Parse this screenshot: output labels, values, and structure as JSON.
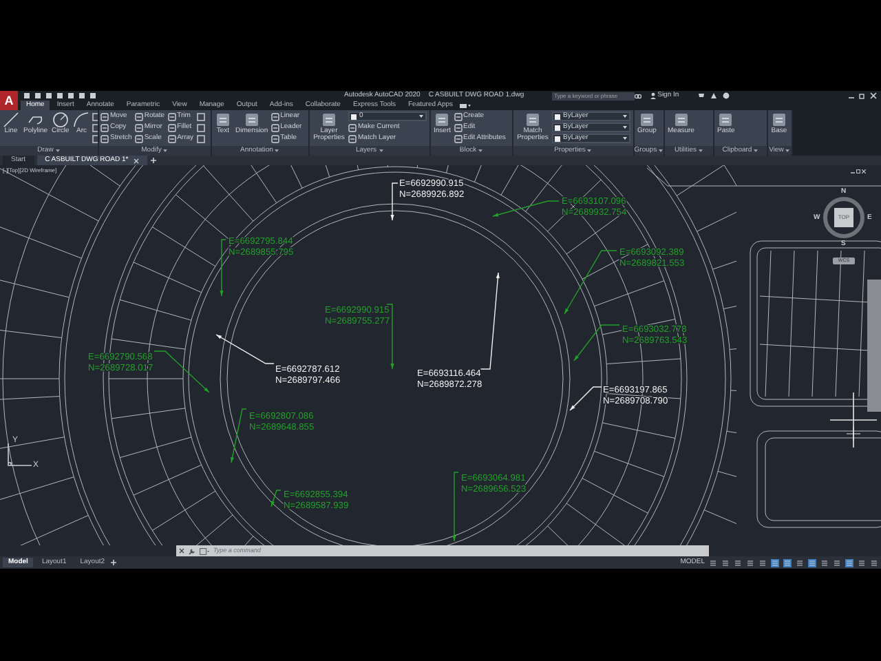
{
  "title_bar": {
    "app_logo": "A",
    "app": "Autodesk AutoCAD 2020",
    "document": "C ASBUILT DWG ROAD 1.dwg",
    "search": {
      "placeholder": "Type a keyword or phrase"
    },
    "sign_in": "Sign In"
  },
  "ribbon_tabs": [
    {
      "label": "Home",
      "selected": true
    },
    {
      "label": "Insert",
      "selected": false
    },
    {
      "label": "Annotate",
      "selected": false
    },
    {
      "label": "Parametric",
      "selected": false
    },
    {
      "label": "View",
      "selected": false
    },
    {
      "label": "Manage",
      "selected": false
    },
    {
      "label": "Output",
      "selected": false
    },
    {
      "label": "Add-ins",
      "selected": false
    },
    {
      "label": "Collaborate",
      "selected": false
    },
    {
      "label": "Express Tools",
      "selected": false
    },
    {
      "label": "Featured Apps",
      "selected": false
    }
  ],
  "ribbon_panels": [
    {
      "title": "Draw",
      "tools": [
        {
          "kind": "large",
          "label": "Line"
        },
        {
          "kind": "large",
          "label": "Polyline"
        },
        {
          "kind": "large",
          "label": "Circle"
        },
        {
          "kind": "large",
          "label": "Arc"
        },
        {
          "kind": "icon"
        },
        {
          "kind": "icon"
        },
        {
          "kind": "icon"
        }
      ]
    },
    {
      "title": "Modify",
      "tools": [
        {
          "kind": "small",
          "label": "Move"
        },
        {
          "kind": "small",
          "label": "Copy"
        },
        {
          "kind": "small",
          "label": "Stretch"
        },
        {
          "kind": "small",
          "label": "Rotate"
        },
        {
          "kind": "small",
          "label": "Mirror"
        },
        {
          "kind": "small",
          "label": "Scale"
        },
        {
          "kind": "small",
          "label": "Trim"
        },
        {
          "kind": "small",
          "label": "Fillet"
        },
        {
          "kind": "small",
          "label": "Array"
        },
        {
          "kind": "icon"
        },
        {
          "kind": "icon"
        },
        {
          "kind": "icon"
        }
      ]
    },
    {
      "title": "Annotation",
      "tools": [
        {
          "kind": "large",
          "label": "Text"
        },
        {
          "kind": "large",
          "label": "Dimension"
        },
        {
          "kind": "small",
          "label": "Linear"
        },
        {
          "kind": "small",
          "label": "Leader"
        },
        {
          "kind": "small",
          "label": "Table"
        }
      ]
    },
    {
      "title": "Layers",
      "tools": [
        {
          "kind": "large",
          "label": "Layer Properties"
        },
        {
          "kind": "dropdown",
          "label": "0"
        },
        {
          "kind": "small",
          "label": "Make Current"
        },
        {
          "kind": "small",
          "label": "Match Layer"
        }
      ]
    },
    {
      "title": "Block",
      "tools": [
        {
          "kind": "large",
          "label": "Insert"
        },
        {
          "kind": "small",
          "label": "Create"
        },
        {
          "kind": "small",
          "label": "Edit"
        },
        {
          "kind": "small",
          "label": "Edit Attributes"
        }
      ]
    },
    {
      "title": "Properties",
      "tools": [
        {
          "kind": "large",
          "label": "Match Properties"
        },
        {
          "kind": "dropdown",
          "label": "ByLayer"
        },
        {
          "kind": "dropdown",
          "label": "ByLayer"
        },
        {
          "kind": "dropdown",
          "label": "ByLayer"
        }
      ]
    },
    {
      "title": "Groups",
      "tools": [
        {
          "kind": "large",
          "label": "Group"
        }
      ]
    },
    {
      "title": "Utilities",
      "tools": [
        {
          "kind": "large",
          "label": "Measure"
        }
      ]
    },
    {
      "title": "Clipboard",
      "tools": [
        {
          "kind": "large",
          "label": "Paste"
        }
      ]
    },
    {
      "title": "View",
      "tools": [
        {
          "kind": "large",
          "label": "Base"
        }
      ]
    }
  ],
  "file_tabs": [
    {
      "label": "Start",
      "selected": false,
      "closable": false
    },
    {
      "label": "C ASBUILT DWG ROAD 1*",
      "selected": true,
      "closable": true
    }
  ],
  "viewport_label": "[-][Top][2D Wireframe]",
  "viewcube": {
    "face": "TOP",
    "north": "N",
    "south": "S",
    "east": "E",
    "west": "W",
    "ucs": "WCS"
  },
  "ucs_icon": {
    "x": "X",
    "y": "Y"
  },
  "coordinate_labels": [
    {
      "e": "E=6692990.915",
      "n": "N=2689926.892",
      "color": "#f0f0f0"
    },
    {
      "e": "E=6692787.612",
      "n": "N=2689797.466",
      "color": "#f0f0f0"
    },
    {
      "e": "E=6693116.464",
      "n": "N=2689872.278",
      "color": "#f0f0f0"
    },
    {
      "e": "E=6693197.865",
      "n": "N=2689708.790",
      "color": "#f0f0f0"
    },
    {
      "e": "E=6693107.096",
      "n": "N=2689932.754",
      "color": "#22a02a"
    },
    {
      "e": "E=6692795.844",
      "n": "N=2689855.795",
      "color": "#22a02a"
    },
    {
      "e": "E=6693092.389",
      "n": "N=2689821.553",
      "color": "#22a02a"
    },
    {
      "e": "E=6692990.915",
      "n": "N=2689755.277",
      "color": "#22a02a"
    },
    {
      "e": "E=6693032.778",
      "n": "N=2689763.543",
      "color": "#22a02a"
    },
    {
      "e": "E=6692790.568",
      "n": "N=2689728.017",
      "color": "#22a02a"
    },
    {
      "e": "E=6692807.086",
      "n": "N=2689648.855",
      "color": "#22a02a"
    },
    {
      "e": "E=6693064.981",
      "n": "N=2689656.523",
      "color": "#22a02a"
    },
    {
      "e": "E=6692855.394",
      "n": "N=2689587.939",
      "color": "#22a02a"
    }
  ],
  "command_line": {
    "placeholder": "Type a command"
  },
  "layout_tabs": [
    {
      "label": "Model",
      "selected": true
    },
    {
      "label": "Layout1",
      "selected": false
    },
    {
      "label": "Layout2",
      "selected": false
    }
  ],
  "status_bar": {
    "mode": "MODEL"
  }
}
